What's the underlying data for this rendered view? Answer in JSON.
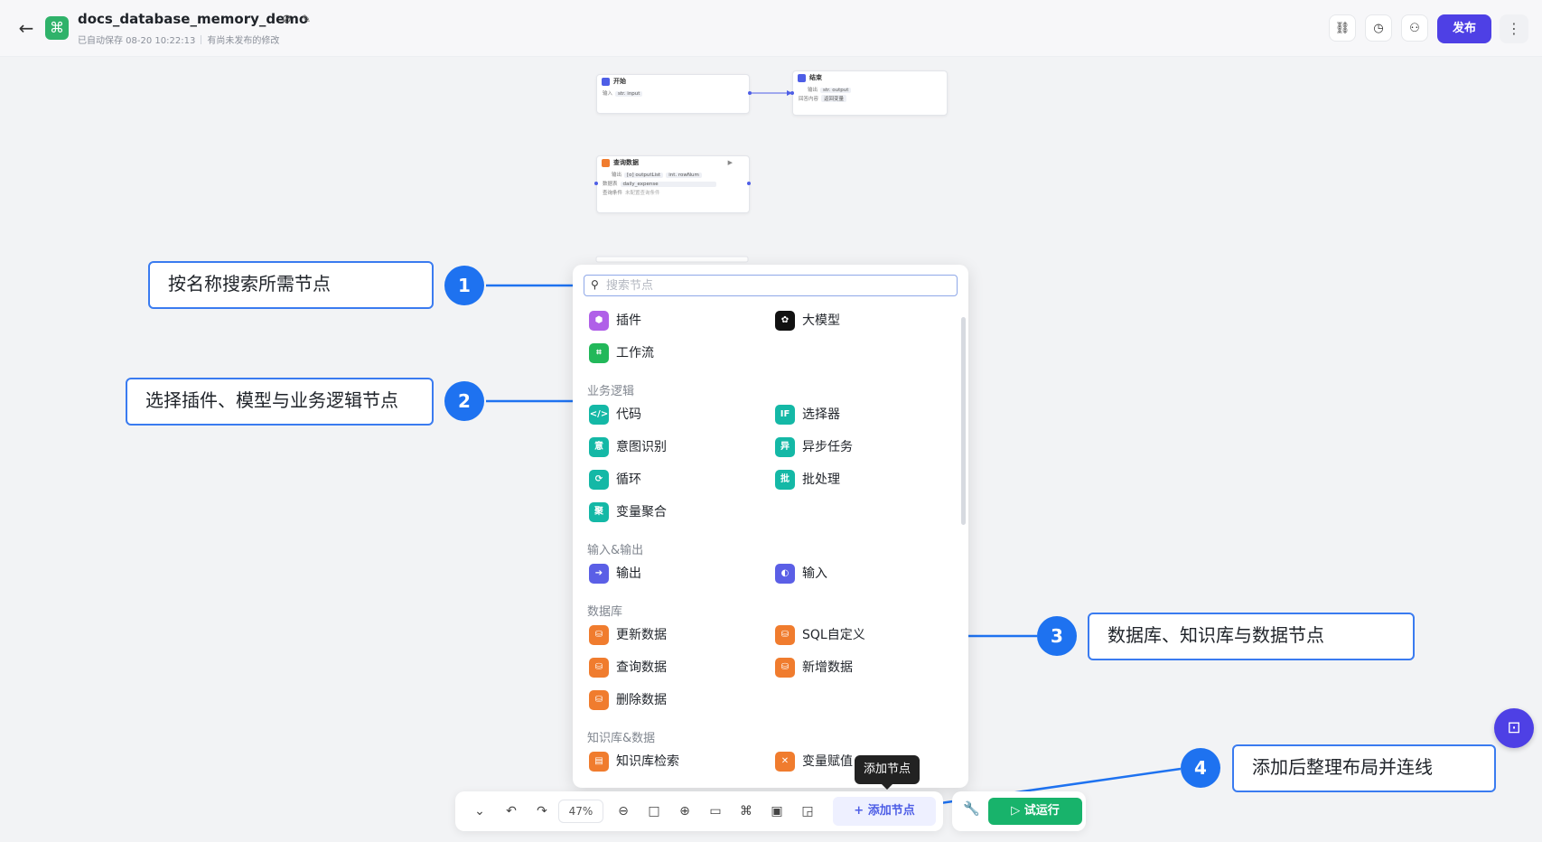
{
  "header": {
    "title": "docs_database_memory_demo",
    "autosave": "已自动保存 08-20 10:22:13",
    "unpublished": "有尚未发布的修改",
    "publish_label": "发布"
  },
  "canvas": {
    "start_node": {
      "title": "开始",
      "row_label": "输入",
      "row_value": "str. input"
    },
    "end_node": {
      "title": "结束",
      "row1_label": "输出",
      "row1_value": "str. output",
      "row2_label": "回答内容",
      "row2_value": "返回变量"
    },
    "query_node": {
      "title": "查询数据",
      "row1_label": "输出",
      "row1_v1": "[o] outputList",
      "row1_v2": "int. rowNum",
      "row2_label": "数据表",
      "row2_value": "daily_expense",
      "row3_label": "查询条件",
      "row3_value": "未配置查询条件"
    }
  },
  "callouts": [
    {
      "number": "1",
      "text": "按名称搜索所需节点"
    },
    {
      "number": "2",
      "text": "选择插件、模型与业务逻辑节点"
    },
    {
      "number": "3",
      "text": "数据库、知识库与数据节点"
    },
    {
      "number": "4",
      "text": "添加后整理布局并连线"
    }
  ],
  "panel": {
    "search_placeholder": "搜索节点",
    "top_items": [
      "插件",
      "大模型",
      "工作流"
    ],
    "sections": [
      {
        "title": "业务逻辑",
        "items": [
          "代码",
          "选择器",
          "意图识别",
          "异步任务",
          "循环",
          "批处理",
          "变量聚合"
        ]
      },
      {
        "title": "输入&输出",
        "items": [
          "输出",
          "输入"
        ]
      },
      {
        "title": "数据库",
        "items": [
          "更新数据",
          "SQL自定义",
          "查询数据",
          "新增数据",
          "删除数据"
        ]
      },
      {
        "title": "知识库&数据",
        "items": [
          "知识库检索",
          "变量赋值"
        ]
      }
    ]
  },
  "toolbar": {
    "zoom": "47%",
    "add_node": "+ 添加节点",
    "tooltip": "添加节点",
    "run_label": "试运行"
  },
  "colors": {
    "accent": "#4e40e5",
    "callout_blue": "#1e72f0",
    "run_green": "#18b36b",
    "db_orange": "#f07c2e",
    "logic_teal": "#14b8a6"
  }
}
